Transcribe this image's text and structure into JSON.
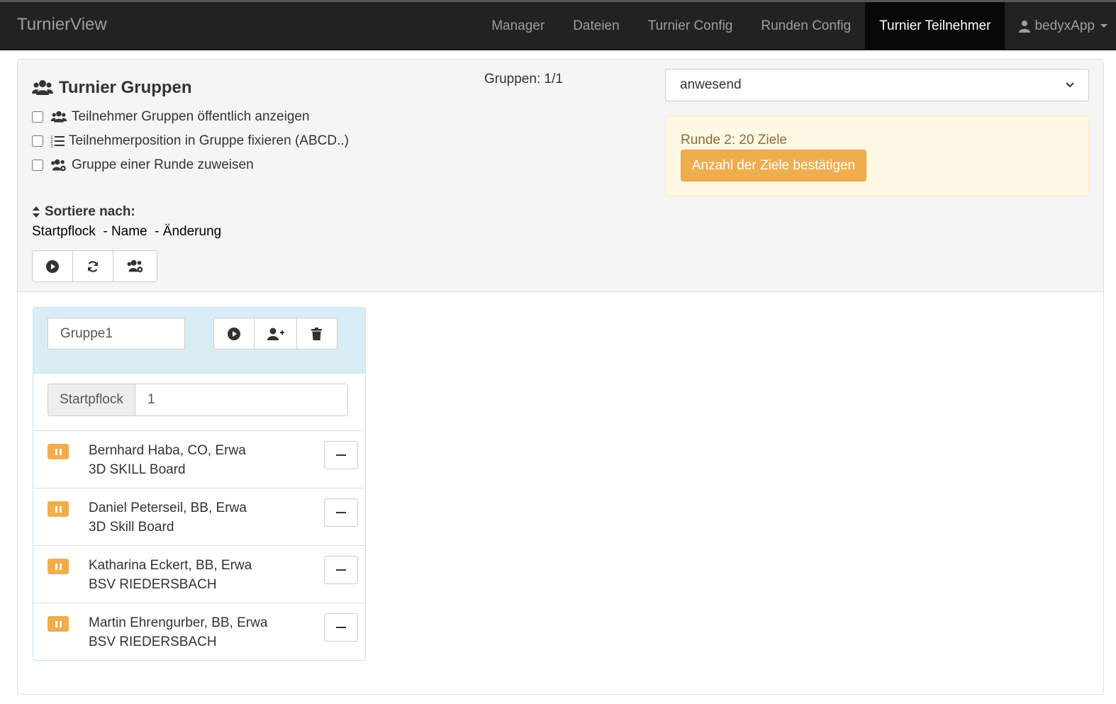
{
  "navbar": {
    "brand": "TurnierView",
    "links": [
      {
        "label": "Manager"
      },
      {
        "label": "Dateien"
      },
      {
        "label": "Turnier Config"
      },
      {
        "label": "Runden Config"
      },
      {
        "label": "Turnier Teilnehmer",
        "active": true
      }
    ],
    "user": "bedyxApp"
  },
  "heading": {
    "title": "Turnier Gruppen",
    "gruppen_count": "Gruppen: 1/1",
    "checkboxes": [
      {
        "label": "Teilnehmer Gruppen öffentlich anzeigen",
        "checked": false,
        "icon": "users-icon"
      },
      {
        "label": "Teilnehmerposition in Gruppe fixieren (ABCD..)",
        "checked": false,
        "icon": "ordered-list-icon"
      },
      {
        "label": "Gruppe einer Runde zuweisen",
        "checked": false,
        "icon": "users-gear-icon"
      }
    ],
    "sort_title": "Sortiere nach:",
    "sort_options": [
      "Startpflock",
      "Name",
      "Änderung"
    ],
    "filter_select": {
      "value": "anwesend"
    },
    "alert": {
      "text": "Runde 2: 20 Ziele",
      "button": "Anzahl der Ziele bestätigen"
    }
  },
  "group": {
    "name": "Gruppe1",
    "startpflock_label": "Startpflock",
    "startpflock_value": "1",
    "members": [
      {
        "name": "Bernhard Haba, CO, Erwa",
        "club": "3D SKILL Board"
      },
      {
        "name": "Daniel Peterseil, BB, Erwa",
        "club": "3D Skill Board"
      },
      {
        "name": "Katharina Eckert, BB, Erwa",
        "club": "BSV RIEDERSBACH"
      },
      {
        "name": "Martin Ehrengurber, BB, Erwa",
        "club": "BSV RIEDERSBACH"
      }
    ]
  },
  "colors": {
    "navbar_bg": "#222222",
    "warning": "#f0ad4e",
    "info_bg": "#d9edf7",
    "alert_bg": "#fcf8e3"
  }
}
